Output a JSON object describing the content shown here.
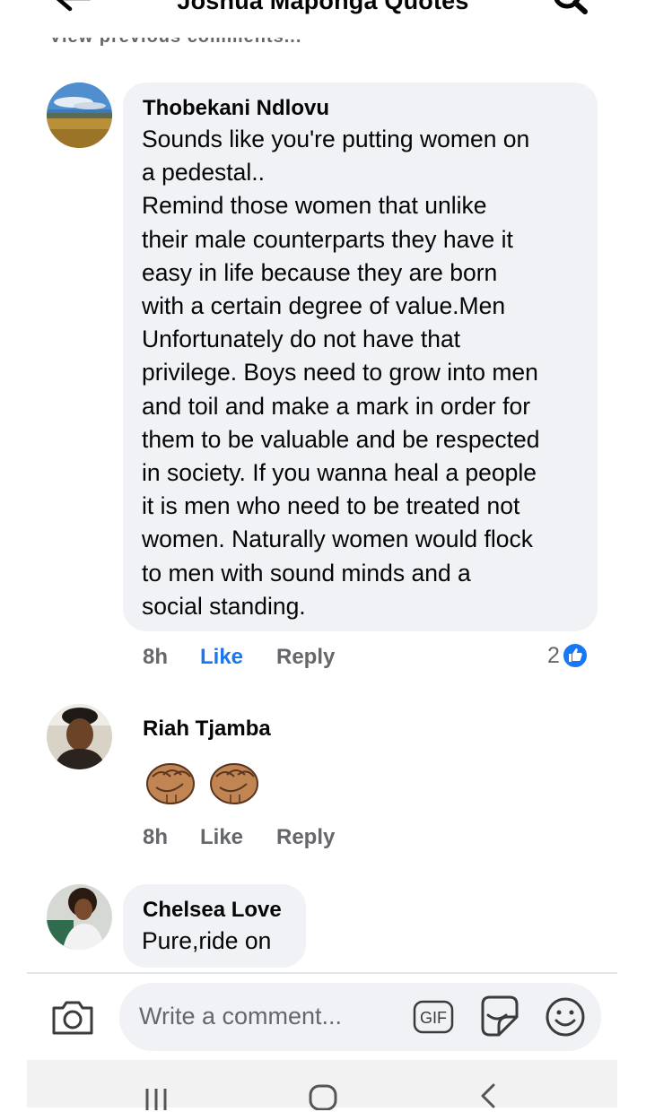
{
  "header": {
    "title": "Joshua Maponga Quotes",
    "back_icon": "arrow-left-icon",
    "search_icon": "search-icon"
  },
  "previous_comments_link": "View previous comments...",
  "comments": [
    {
      "author": "Thobekani Ndlovu",
      "text_lines": [
        "Sounds like you're putting women on",
        "a pedestal..",
        "Remind those women that unlike",
        "their male counterparts they have it",
        "easy in life because they are born",
        "with a certain degree of value.Men",
        "Unfortunately do not have that",
        "privilege. Boys need to grow into men",
        "and toil and make a mark in order for",
        "them to be valuable and be respected",
        "in society. If you wanna heal a people",
        "it is men who need to be treated not",
        "women. Naturally women would flock",
        "to men with sound minds and a",
        "social standing."
      ],
      "time": "8h",
      "like_label": "Like",
      "liked": true,
      "reply_label": "Reply",
      "reaction_count": "2",
      "reaction_icon": "thumbs-up-icon"
    },
    {
      "author": "Riah Tjamba",
      "emoji": [
        "raised-fist-medium-dark-skin",
        "raised-fist-medium-dark-skin"
      ],
      "time": "8h",
      "like_label": "Like",
      "liked": false,
      "reply_label": "Reply"
    },
    {
      "author": "Chelsea Love",
      "text": "Pure,ride on"
    }
  ],
  "composer": {
    "placeholder": "Write a comment...",
    "gif_label": "GIF",
    "camera_icon": "camera-icon",
    "sticker_icon": "sticker-icon",
    "emoji_icon": "smiley-icon"
  },
  "colors": {
    "accent": "#1877f2",
    "bubble": "#f0f2f5",
    "secondary_text": "#65676b"
  }
}
